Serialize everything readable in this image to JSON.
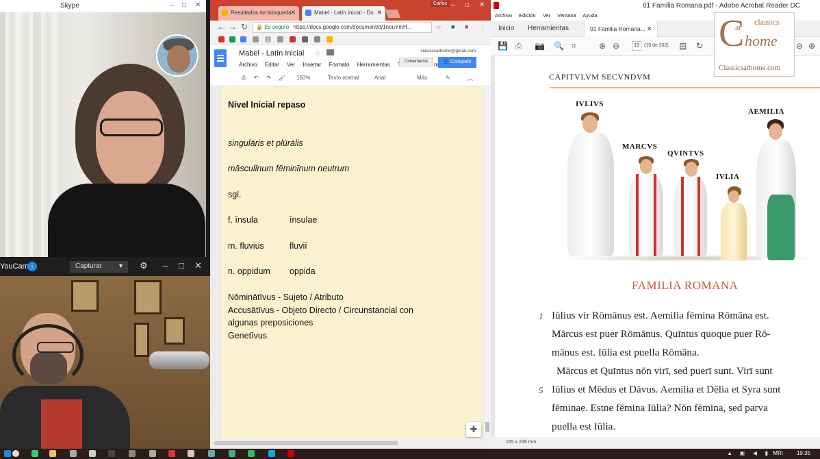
{
  "skype": {
    "title": "Skype",
    "window_controls": [
      "–",
      "□",
      "✕"
    ]
  },
  "youcam": {
    "app_name": "YouCam",
    "mode_select": "Capturar",
    "controls": [
      "⚙",
      "–",
      "□",
      "✕"
    ]
  },
  "chrome": {
    "user": "Carlos",
    "tabs": [
      {
        "label": "Resultados de búsqueda",
        "icon": "drive-icon"
      },
      {
        "label": "Mabel - Latín Inicial - Do",
        "icon": "docs-icon"
      }
    ],
    "address": {
      "secure_label": "Es seguro",
      "url": "https://docs.google.com/document/d/1nouYmH..."
    },
    "docs": {
      "title": "Mabel - Latín Inicial",
      "account": "classicsathome@gmail.com",
      "menus": [
        "Archivo",
        "Editar",
        "Ver",
        "Insertar",
        "Formato",
        "Herramientas",
        "T"
      ],
      "menus_tail": "m",
      "comments_label": "Comentarios",
      "share_label": "Compartir",
      "toolbar": {
        "zoom": "150%",
        "style": "Texto normal",
        "font": "Arial",
        "more": "Más"
      }
    },
    "document": {
      "heading": "Nivel Inicial repaso",
      "line_sing_plur": "singulāris et plūrālis",
      "line_genders": "māsculīnum fēminīnum neutrum",
      "sgl": "sgl.",
      "rows": [
        {
          "a": "f. īnsula",
          "b": "īnsulae"
        },
        {
          "a": "m. fluvius",
          "b": "fluviī"
        },
        {
          "a": "n. oppidum",
          "b": "oppida"
        }
      ],
      "cases": [
        "Nōminātīvus - Sujeto / Atributo",
        "Accusātīvus -  Objeto Directo / Circunstancial con",
        "algunas preposiciones",
        "Genetīvus"
      ]
    }
  },
  "acrobat": {
    "title": "01 Familia Romana.pdf - Adobe Acrobat Reader DC",
    "menu": [
      "Archivo",
      "Edición",
      "Ver",
      "Ventana",
      "Ayuda"
    ],
    "tabs": {
      "home": "Inicio",
      "tools": "Herramientas",
      "doc": "01 Familia Romana..."
    },
    "page_num": "13",
    "page_count": "(15 de 332)",
    "page_size": "165 x 235 mm",
    "logo": {
      "at": "at",
      "classics": "classics",
      "home": "home",
      "site": "Classicsathome.com"
    },
    "pdf": {
      "chapter": "CAPITVLVM SECVNDVM",
      "names": {
        "iulius": "IVLIVS",
        "aemilia": "AEMILIA",
        "marcus": "MARCVS",
        "quintus": "QVINTVS",
        "iulia": "IVLIA"
      },
      "subtitle": "FAMILIA ROMANA",
      "line_numbers": [
        "1",
        "5"
      ],
      "text_lines": [
        "Iūlius vir Rōmānus est. Aemilia fēmina Rōmāna est.",
        "Mārcus est puer Rōmānus. Quīntus quoque puer Rō-",
        "mānus est. Iūlia est puella Rōmāna.",
        "   Mārcus et Quīntus nōn virī, sed puerī sunt. Virī sunt",
        "Iūlius et Mēdus et Dāvus. Aemilia et Dēlia et Syra sunt",
        "fēminae. Estne fēmina Iūlia? Nōn fēmina, sed parva",
        "puella est Iūlia."
      ]
    }
  },
  "taskbar": {
    "language": "MRI",
    "time": "19:35"
  }
}
